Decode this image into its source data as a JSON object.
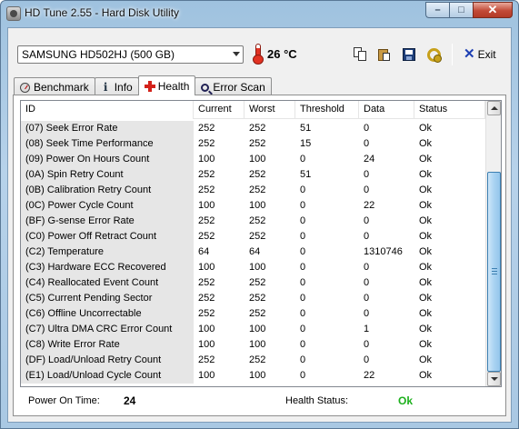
{
  "window": {
    "title": "HD Tune 2.55 - Hard Disk Utility",
    "controls": {
      "minimize": "–",
      "maximize": "□",
      "close": "✕"
    }
  },
  "toolbar": {
    "drive": "SAMSUNG HD502HJ (500 GB)",
    "temperature": "26 °C",
    "exit_label": "Exit",
    "icons": [
      "copy-icon",
      "clipboard-icon",
      "save-icon",
      "options-icon",
      "exit-icon"
    ]
  },
  "tabs": [
    {
      "label": "Benchmark",
      "icon": "benchmark-icon",
      "active": false
    },
    {
      "label": "Info",
      "icon": "info-icon",
      "active": false
    },
    {
      "label": "Health",
      "icon": "health-icon",
      "active": true
    },
    {
      "label": "Error Scan",
      "icon": "error-scan-icon",
      "active": false
    }
  ],
  "health": {
    "columns": [
      "ID",
      "Current",
      "Worst",
      "Threshold",
      "Data",
      "Status"
    ],
    "rows": [
      [
        "(07) Seek Error Rate",
        "252",
        "252",
        "51",
        "0",
        "Ok"
      ],
      [
        "(08) Seek Time Performance",
        "252",
        "252",
        "15",
        "0",
        "Ok"
      ],
      [
        "(09) Power On Hours Count",
        "100",
        "100",
        "0",
        "24",
        "Ok"
      ],
      [
        "(0A) Spin Retry Count",
        "252",
        "252",
        "51",
        "0",
        "Ok"
      ],
      [
        "(0B) Calibration Retry Count",
        "252",
        "252",
        "0",
        "0",
        "Ok"
      ],
      [
        "(0C) Power Cycle Count",
        "100",
        "100",
        "0",
        "22",
        "Ok"
      ],
      [
        "(BF) G-sense Error Rate",
        "252",
        "252",
        "0",
        "0",
        "Ok"
      ],
      [
        "(C0) Power Off Retract Count",
        "252",
        "252",
        "0",
        "0",
        "Ok"
      ],
      [
        "(C2) Temperature",
        "64",
        "64",
        "0",
        "1310746",
        "Ok"
      ],
      [
        "(C3) Hardware ECC Recovered",
        "100",
        "100",
        "0",
        "0",
        "Ok"
      ],
      [
        "(C4) Reallocated Event Count",
        "252",
        "252",
        "0",
        "0",
        "Ok"
      ],
      [
        "(C5) Current Pending Sector",
        "252",
        "252",
        "0",
        "0",
        "Ok"
      ],
      [
        "(C6) Offline Uncorrectable",
        "252",
        "252",
        "0",
        "0",
        "Ok"
      ],
      [
        "(C7) Ultra DMA CRC Error Count",
        "100",
        "100",
        "0",
        "1",
        "Ok"
      ],
      [
        "(C8) Write Error Rate",
        "100",
        "100",
        "0",
        "0",
        "Ok"
      ],
      [
        "(DF) Load/Unload Retry Count",
        "252",
        "252",
        "0",
        "0",
        "Ok"
      ],
      [
        "(E1) Load/Unload Cycle Count",
        "100",
        "100",
        "0",
        "22",
        "Ok"
      ]
    ]
  },
  "status_bar": {
    "power_on_time_label": "Power On Time:",
    "power_on_time_value": "24",
    "health_status_label": "Health Status:",
    "health_status_value": "Ok"
  },
  "colors": {
    "health_ok": "#1cb01c",
    "id_column_bg": "#e6e6e6"
  }
}
